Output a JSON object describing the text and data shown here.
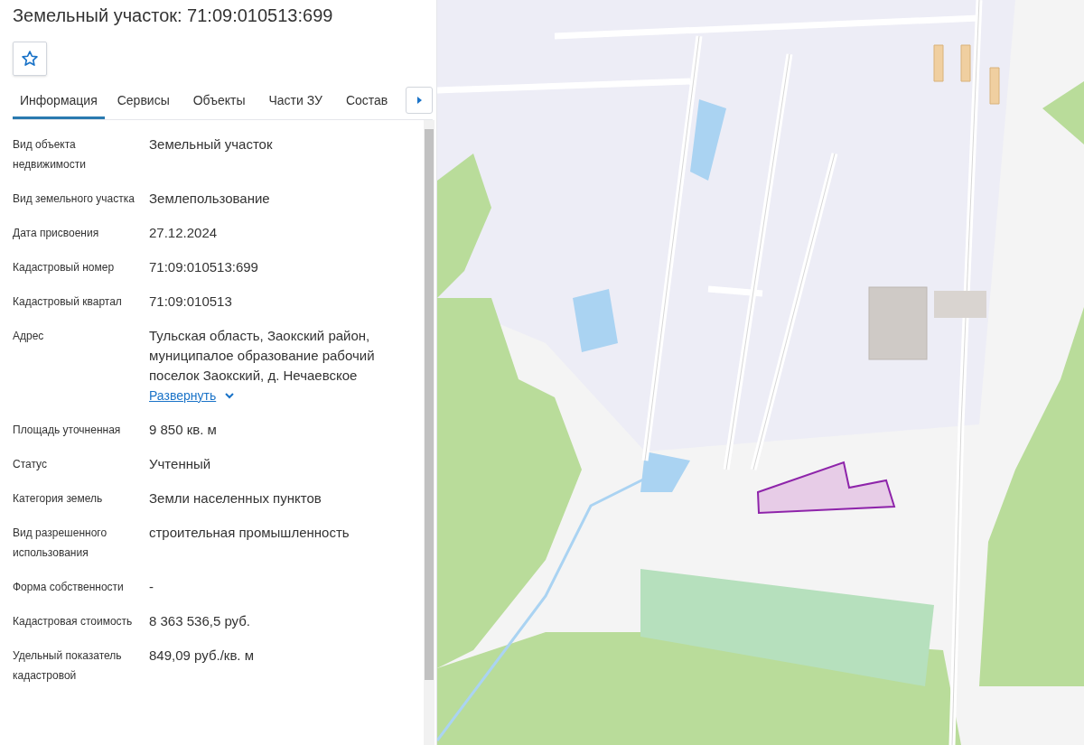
{
  "title": "Земельный участок: 71:09:010513:699",
  "favorite": {
    "on": false
  },
  "tabs": [
    {
      "label": "Информация",
      "selected": true
    },
    {
      "label": "Сервисы",
      "selected": false
    },
    {
      "label": "Объекты",
      "selected": false
    },
    {
      "label": "Части ЗУ",
      "selected": false
    },
    {
      "label": "Состав",
      "selected": false
    }
  ],
  "fields": [
    {
      "label": "Вид объекта недвижимости",
      "value": "Земельный участок"
    },
    {
      "label": "Вид земельного участка",
      "value": "Землепользование"
    },
    {
      "label": "Дата присвоения",
      "value": "27.12.2024"
    },
    {
      "label": "Кадастровый номер",
      "value": "71:09:010513:699"
    },
    {
      "label": "Кадастровый квартал",
      "value": "71:09:010513"
    },
    {
      "label": "Адрес",
      "value": "Тульская область, Заокский район, муниципалое образование рабочий поселок Заокский, д. Нечаевское",
      "link": "Развернуть"
    },
    {
      "label": "Площадь уточненная",
      "value": "9 850 кв. м"
    },
    {
      "label": "Статус",
      "value": "Учтенный"
    },
    {
      "label": "Категория земель",
      "value": "Земли населенных пунктов"
    },
    {
      "label": "Вид разрешенного использования",
      "value": "строительная промышленность"
    },
    {
      "label": "Форма собственности",
      "value": "-"
    },
    {
      "label": "Кадастровая стоимость",
      "value": "8 363 536,5 руб."
    },
    {
      "label": "Удельный показатель кадастровой",
      "value": "849,09 руб./кв. м"
    }
  ]
}
